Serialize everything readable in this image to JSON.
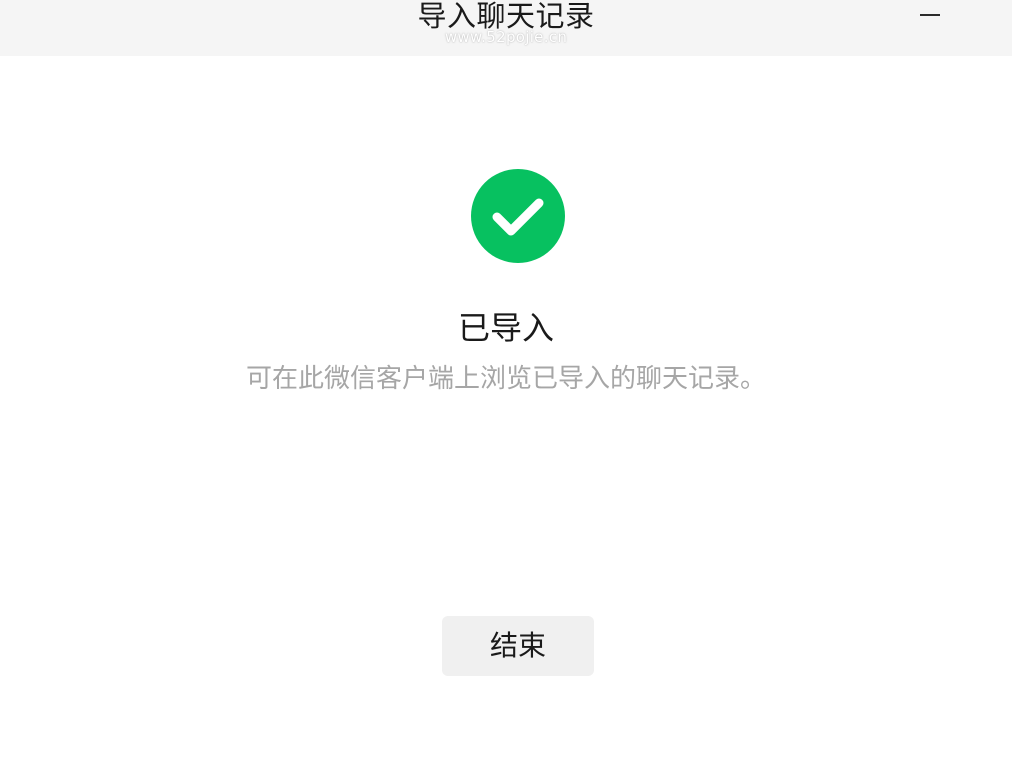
{
  "window": {
    "title": "导入聊天记录",
    "watermark": "www.52pojie.cn",
    "minimize_icon": "minimize-icon"
  },
  "status": {
    "icon": "check-circle-icon",
    "icon_color": "#07c160",
    "title": "已导入",
    "description": "可在此微信客户端上浏览已导入的聊天记录。"
  },
  "actions": {
    "finish_label": "结束"
  }
}
